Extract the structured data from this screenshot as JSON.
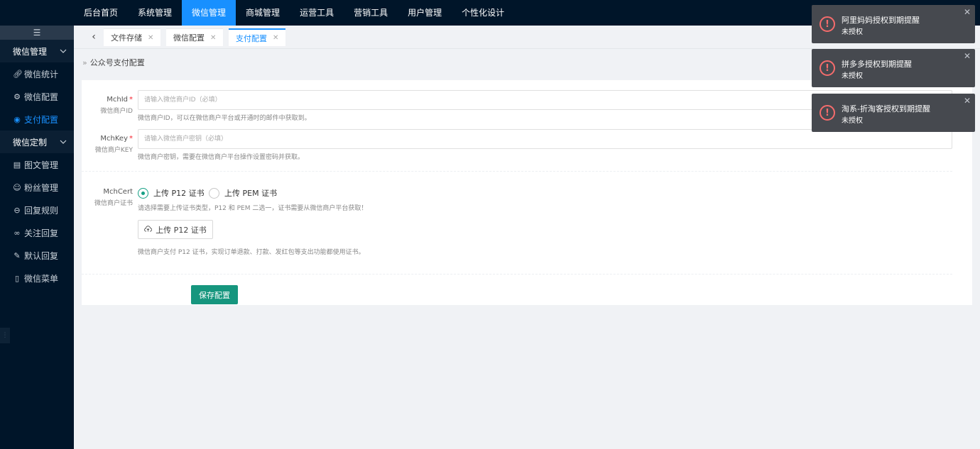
{
  "topnav": {
    "items": [
      {
        "label": "后台首页",
        "active": false
      },
      {
        "label": "系统管理",
        "active": false
      },
      {
        "label": "微信管理",
        "active": true
      },
      {
        "label": "商城管理",
        "active": false
      },
      {
        "label": "运营工具",
        "active": false
      },
      {
        "label": "营销工具",
        "active": false
      },
      {
        "label": "用户管理",
        "active": false
      },
      {
        "label": "个性化设计",
        "active": false
      }
    ]
  },
  "sidebar": {
    "collapse_icon": "hamburger-icon",
    "group1": {
      "label": "微信管理",
      "icon": "chevron-down-icon"
    },
    "group1_items": [
      {
        "label": "微信统计",
        "icon": "link-icon",
        "active": false
      },
      {
        "label": "微信配置",
        "icon": "gear-icon",
        "active": false
      },
      {
        "label": "支付配置",
        "icon": "radio-dot-icon",
        "active": true
      }
    ],
    "group2": {
      "label": "微信定制",
      "icon": "chevron-down-icon"
    },
    "group2_items": [
      {
        "label": "图文管理",
        "icon": "news-icon"
      },
      {
        "label": "粉丝管理",
        "icon": "user-icon"
      },
      {
        "label": "回复规则",
        "icon": "reply-icon"
      },
      {
        "label": "关注回复",
        "icon": "infinity-icon"
      },
      {
        "label": "默认回复",
        "icon": "edit-icon"
      },
      {
        "label": "微信菜单",
        "icon": "phone-icon"
      }
    ]
  },
  "tabs": [
    {
      "label": "文件存储",
      "active": false
    },
    {
      "label": "微信配置",
      "active": false
    },
    {
      "label": "支付配置",
      "active": true
    }
  ],
  "breadcrumb": {
    "text": "公众号支付配置"
  },
  "form": {
    "mchid": {
      "label": "MchId",
      "sublabel": "微信商户ID",
      "placeholder": "请输入微信商户ID（必填）",
      "value": "",
      "hint": "微信商户ID，可以在微信商户平台或开通时的邮件中获取到。"
    },
    "mchkey": {
      "label": "MchKey",
      "sublabel": "微信商户KEY",
      "placeholder": "请输入微信商户密钥（必填）",
      "value": "",
      "hint": "微信商户密钥，需要在微信商户平台操作设置密码并获取。"
    },
    "mchcert": {
      "label": "MchCert",
      "sublabel": "微信商户证书",
      "options": [
        {
          "label": "上传 P12 证书",
          "checked": true
        },
        {
          "label": "上传 PEM 证书",
          "checked": false
        }
      ],
      "hint": "请选择需要上传证书类型，P12 和 PEM 二选一，证书需要从微信商户平台获取！",
      "upload_label": "上传 P12 证书",
      "upload_hint": "微信商户支付 P12 证书，实现订单退款、打款、发红包等支出功能都使用证书。"
    },
    "save_label": "保存配置"
  },
  "notices": [
    {
      "title": "阿里妈妈授权到期提醒",
      "message": "未授权"
    },
    {
      "title": "拼多多授权到期提醒",
      "message": "未授权"
    },
    {
      "title": "淘系-折淘客授权到期提醒",
      "message": "未授权"
    }
  ],
  "colors": {
    "topbar": "#001529",
    "active_nav": "#1890ff",
    "primary_button": "#16967e",
    "notice_bg": "#46494f",
    "notice_icon": "#f56c6c"
  }
}
